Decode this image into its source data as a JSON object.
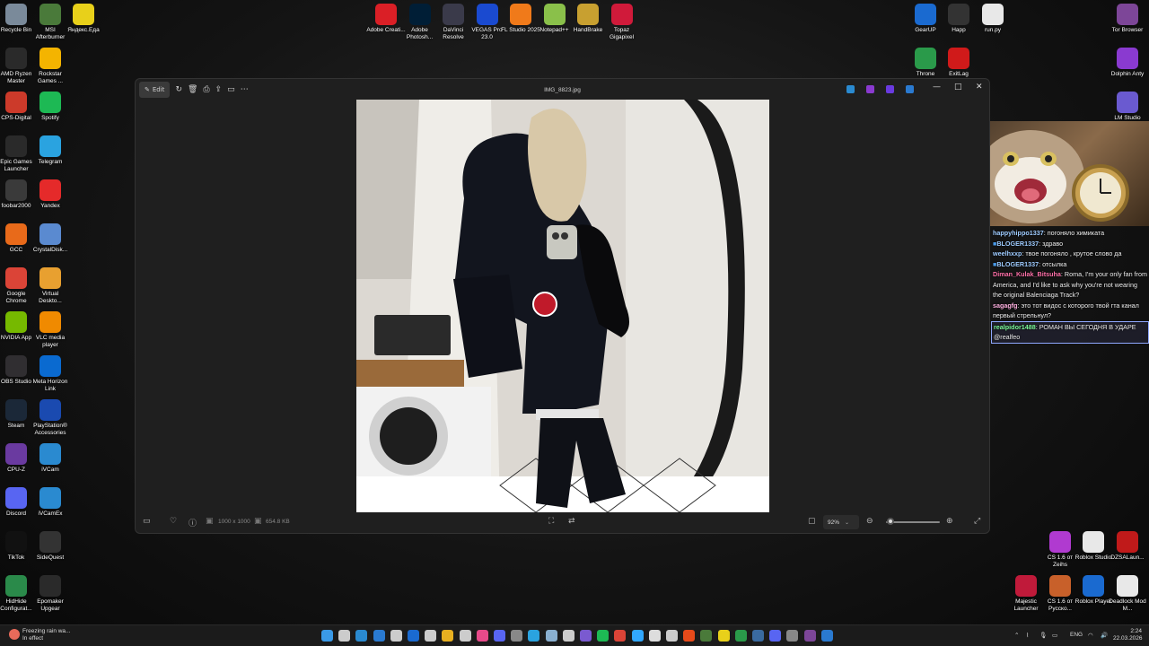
{
  "desktop": {
    "left_icons": [
      {
        "label": "Recycle Bin",
        "icon": "recycle-bin-icon",
        "color": "#7a8a9a"
      },
      {
        "label": "MSI Afterburner",
        "icon": "afterburner-icon",
        "color": "#4a7a3a"
      },
      {
        "label": "Яндекс.Еда",
        "icon": "yandex-eda-icon",
        "color": "#e8d01a"
      },
      {
        "label": "AMD Ryzen Master",
        "icon": "ryzen-master-icon",
        "color": "#2a2a2a"
      },
      {
        "label": "Rockstar Games ...",
        "icon": "rockstar-icon",
        "color": "#f4b400"
      },
      {
        "label": "CPS-Digital",
        "icon": "cps-digital-icon",
        "color": "#cc3a2a"
      },
      {
        "label": "Spotify",
        "icon": "spotify-icon",
        "color": "#1db954"
      },
      {
        "label": "Epic Games Launcher",
        "icon": "epic-games-icon",
        "color": "#2a2a2a"
      },
      {
        "label": "Telegram",
        "icon": "telegram-icon",
        "color": "#2aa3e0"
      },
      {
        "label": "foobar2000",
        "icon": "foobar-icon",
        "color": "#3a3a3a"
      },
      {
        "label": "Yandex",
        "icon": "yandex-browser-icon",
        "color": "#e52a2a"
      },
      {
        "label": "GCC",
        "icon": "gcc-icon",
        "color": "#e86a1a"
      },
      {
        "label": "CrystalDisk...",
        "icon": "crystaldisk-icon",
        "color": "#5a8ad0"
      },
      {
        "label": "Google Chrome",
        "icon": "chrome-icon",
        "color": "#db4437"
      },
      {
        "label": "Virtual Deskto...",
        "icon": "virtual-desktop-icon",
        "color": "#e8a030"
      },
      {
        "label": "NVIDIA App",
        "icon": "nvidia-icon",
        "color": "#76b900"
      },
      {
        "label": "VLC media player",
        "icon": "vlc-icon",
        "color": "#f08a00"
      },
      {
        "label": "OBS Studio",
        "icon": "obs-icon",
        "color": "#302e31"
      },
      {
        "label": "Meta Horizon Link",
        "icon": "meta-icon",
        "color": "#0a6ad0"
      },
      {
        "label": "Steam",
        "icon": "steam-icon",
        "color": "#1b2838"
      },
      {
        "label": "PlayStation® Accessories",
        "icon": "playstation-icon",
        "color": "#1a4ab0"
      },
      {
        "label": "CPU-Z",
        "icon": "cpu-z-icon",
        "color": "#6a3aa0"
      },
      {
        "label": "iVCam",
        "icon": "ivcam-icon",
        "color": "#2a8ad0"
      },
      {
        "label": "Discord",
        "icon": "discord-icon",
        "color": "#5865f2"
      },
      {
        "label": "iVCamEx",
        "icon": "ivcamex-icon",
        "color": "#2a8ad0"
      },
      {
        "label": "TikTok",
        "icon": "tiktok-icon",
        "color": "#111111"
      },
      {
        "label": "SideQuest",
        "icon": "sidequest-icon",
        "color": "#333333"
      },
      {
        "label": "HidHide Configurat...",
        "icon": "hidhide-icon",
        "color": "#2a8a4a"
      },
      {
        "label": "Epomaker Upgear",
        "icon": "epomaker-icon",
        "color": "#2a2a2a"
      }
    ],
    "top_icons": [
      {
        "label": "Adobe Creati...",
        "icon": "adobe-cc-icon",
        "color": "#da1f26"
      },
      {
        "label": "Adobe Photosh...",
        "icon": "photoshop-icon",
        "color": "#001e36"
      },
      {
        "label": "DaVinci Resolve",
        "icon": "davinci-icon",
        "color": "#3a3a4a"
      },
      {
        "label": "VEGAS Pro 23.0",
        "icon": "vegas-icon",
        "color": "#1a4ad0"
      },
      {
        "label": "FL Studio 2025",
        "icon": "fl-studio-icon",
        "color": "#f07a1a"
      },
      {
        "label": "Notepad++",
        "icon": "notepadpp-icon",
        "color": "#8ac04a"
      },
      {
        "label": "HandBrake",
        "icon": "handbrake-icon",
        "color": "#c8a030"
      },
      {
        "label": "Topaz Gigapixel",
        "icon": "topaz-icon",
        "color": "#d01a3a"
      }
    ],
    "right_icons": [
      {
        "label": "GearUP",
        "icon": "gearup-icon",
        "color": "#1a6ad0"
      },
      {
        "label": "Happ",
        "icon": "happ-icon",
        "color": "#333333"
      },
      {
        "label": "run.py",
        "icon": "python-file-icon",
        "color": "#e8e8e8"
      },
      {
        "label": "Tor Browser",
        "icon": "tor-icon",
        "color": "#7d4698"
      },
      {
        "label": "Throne",
        "icon": "throne-icon",
        "color": "#2a9a4a"
      },
      {
        "label": "ExitLag",
        "icon": "exitlag-icon",
        "color": "#d01a1a"
      },
      {
        "label": "Dolphin Anty",
        "icon": "dolphin-icon",
        "color": "#8a3ad0"
      },
      {
        "label": "LM Studio",
        "icon": "lm-studio-icon",
        "color": "#6a5ad0"
      },
      {
        "label": "CS 1.6 от Zeihs",
        "icon": "cs16-zeihs-icon",
        "color": "#b03ad0"
      },
      {
        "label": "Roblox Studio",
        "icon": "roblox-studio-icon",
        "color": "#e8e8e8"
      },
      {
        "label": "DZSALaun...",
        "icon": "dzsa-icon",
        "color": "#c01a1a"
      },
      {
        "label": "Majestic Launcher",
        "icon": "majestic-icon",
        "color": "#c01a3a"
      },
      {
        "label": "CS 1.6 от Русско...",
        "icon": "cs16-ru-icon",
        "color": "#c8602a"
      },
      {
        "label": "Roblox Player",
        "icon": "roblox-player-icon",
        "color": "#1a6ad0"
      },
      {
        "label": "Deadlock Mod M...",
        "icon": "deadlock-icon",
        "color": "#e8e8e8"
      }
    ]
  },
  "viewer": {
    "title": "IMG_8823.jpg",
    "edit_label": "Edit",
    "dimensions": "1000 x 1000",
    "file_size": "654.8 KB",
    "zoom": "92%",
    "zoom_level": 0.08,
    "minimize": "—",
    "maximize": "□",
    "close": "✕"
  },
  "chat": {
    "messages": [
      {
        "user": "happyhippo1337",
        "text": "погоняло химиката",
        "color": "#9ecbff",
        "badge": false,
        "highlight": false
      },
      {
        "user": "BLOGER1337",
        "text": "здраво",
        "color": "#9ecbff",
        "badge": true,
        "highlight": false
      },
      {
        "user": "weelhxxp",
        "text": "твое погоняло , крутое слово да",
        "color": "#9ecbff",
        "badge": false,
        "highlight": false
      },
      {
        "user": "BLOGER1337",
        "text": "отсылка",
        "color": "#9ecbff",
        "badge": true,
        "highlight": false
      },
      {
        "user": "Diman_Kulak_Bitsuha",
        "text": "Roma, I'm your only fan from America, and I'd like to ask why you're not wearing the original Balenciaga Track?",
        "color": "#ff6fa8",
        "badge": false,
        "highlight": false
      },
      {
        "user": "sagagfg",
        "text": "это тот видос с которого твой гта канал первый стрельнул?",
        "color": "#ffb0e0",
        "badge": false,
        "highlight": false
      },
      {
        "user": "realpidor1488",
        "text": "РОМАН ВЫ СЕГОДНЯ В УДАРЕ @realfeo",
        "color": "#7cfc9a",
        "badge": false,
        "highlight": true
      }
    ]
  },
  "taskbar": {
    "weather_line1": "Freezing rain wa...",
    "weather_line2": "In effect",
    "language": "ENG",
    "time": "2:24",
    "date": "22.03.2026",
    "apps": [
      {
        "icon": "windows-start-icon",
        "color": "#3a9ae8"
      },
      {
        "icon": "search-icon",
        "color": "#cccccc"
      },
      {
        "icon": "task-view-icon",
        "color": "#2a8ad0"
      },
      {
        "icon": "photos-icon",
        "color": "#2a7ad0"
      },
      {
        "icon": "clock-icon",
        "color": "#cccccc"
      },
      {
        "icon": "app-icon",
        "color": "#1a6ad0"
      },
      {
        "icon": "calendar-icon",
        "color": "#cccccc"
      },
      {
        "icon": "file-explorer-icon",
        "color": "#e8b020"
      },
      {
        "icon": "mail-icon",
        "color": "#cccccc"
      },
      {
        "icon": "itunes-icon",
        "color": "#e84a8a"
      },
      {
        "icon": "discord-taskbar-icon",
        "color": "#5865f2"
      },
      {
        "icon": "calculator-icon",
        "color": "#888888"
      },
      {
        "icon": "telegram-taskbar-icon",
        "color": "#2aa3e0"
      },
      {
        "icon": "steam-taskbar-icon",
        "color": "#8ab0d0"
      },
      {
        "icon": "chatgpt-icon",
        "color": "#cccccc"
      },
      {
        "icon": "obsidian-icon",
        "color": "#7a5ad0"
      },
      {
        "icon": "spotify-taskbar-icon",
        "color": "#1db954"
      },
      {
        "icon": "chrome-taskbar-icon",
        "color": "#db4437"
      },
      {
        "icon": "photoshop-taskbar-icon",
        "color": "#31a8ff"
      },
      {
        "icon": "epic-taskbar-icon",
        "color": "#dddddd"
      },
      {
        "icon": "obs-taskbar-icon",
        "color": "#cccccc"
      },
      {
        "icon": "vegas-taskbar-icon",
        "color": "#e84a1a"
      },
      {
        "icon": "afterburner-taskbar-icon",
        "color": "#4a7a3a"
      },
      {
        "icon": "yandex-taskbar-icon",
        "color": "#e8d01a"
      },
      {
        "icon": "throne-taskbar-icon",
        "color": "#2a9a4a"
      },
      {
        "icon": "gearup-taskbar-icon",
        "color": "#3a6aa0"
      },
      {
        "icon": "discord-2-taskbar-icon",
        "color": "#5865f2"
      },
      {
        "icon": "terminal-icon",
        "color": "#888888"
      },
      {
        "icon": "tor-taskbar-icon",
        "color": "#7d4698"
      },
      {
        "icon": "photos-2-taskbar-icon",
        "color": "#2a7ad0"
      }
    ]
  }
}
